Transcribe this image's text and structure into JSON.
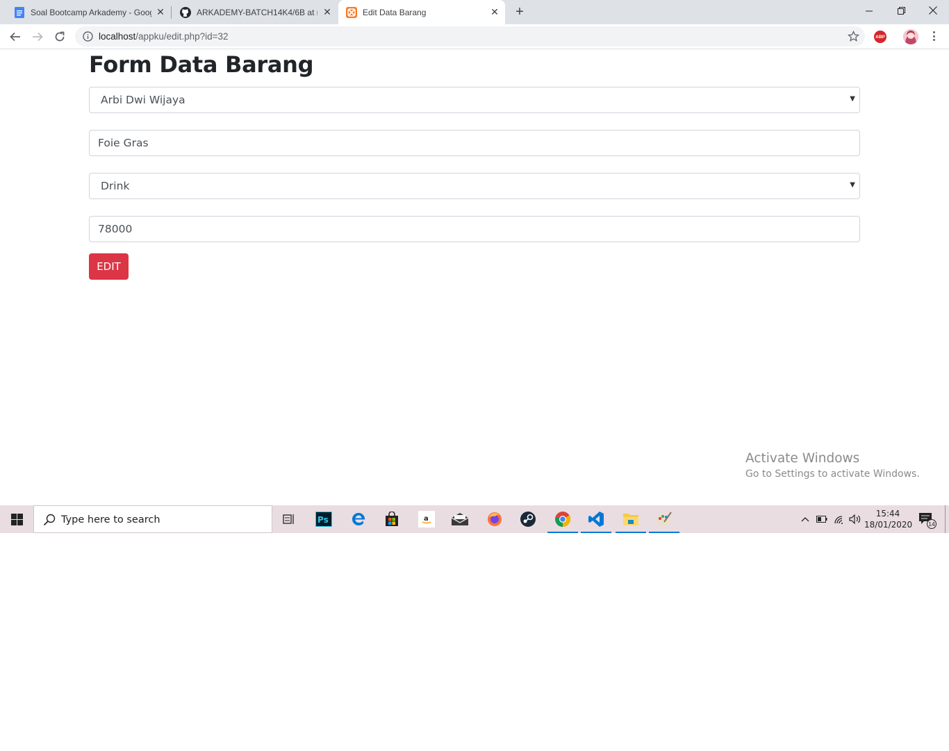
{
  "browser": {
    "tabs": [
      {
        "title": "Soal Bootcamp Arkademy - Goog",
        "icon": "google-docs-icon",
        "active": false
      },
      {
        "title": "ARKADEMY-BATCH14K4/6B at m",
        "icon": "github-icon",
        "active": false
      },
      {
        "title": "Edit Data Barang",
        "icon": "xampp-icon",
        "active": true
      }
    ],
    "address": {
      "host": "localhost",
      "path": "/appku/edit.php?id=32"
    },
    "extension_label": "ABP"
  },
  "page": {
    "heading": "Form Data Barang",
    "fields": {
      "cashier": "Arbi Dwi Wijaya",
      "product_name": "Foie Gras",
      "category": "Drink",
      "price": "78000"
    },
    "submit_label": "EDIT"
  },
  "watermark": {
    "line1": "Activate Windows",
    "line2": "Go to Settings to activate Windows."
  },
  "taskbar": {
    "search_placeholder": "Type here to search",
    "apps": [
      "task-view-icon",
      "photoshop-icon",
      "edge-icon",
      "store-icon",
      "amazon-icon",
      "mail-icon",
      "firefox-icon",
      "steam-icon",
      "chrome-icon",
      "vscode-icon",
      "file-explorer-icon",
      "paint-icon"
    ],
    "photoshop_label": "Ps",
    "amazon_label": "a",
    "time": "15:44",
    "date": "18/01/2020",
    "notification_count": "14"
  },
  "colors": {
    "danger": "#dc3545",
    "tabstrip": "#dee1e6",
    "taskbar": "#e9dde2"
  }
}
